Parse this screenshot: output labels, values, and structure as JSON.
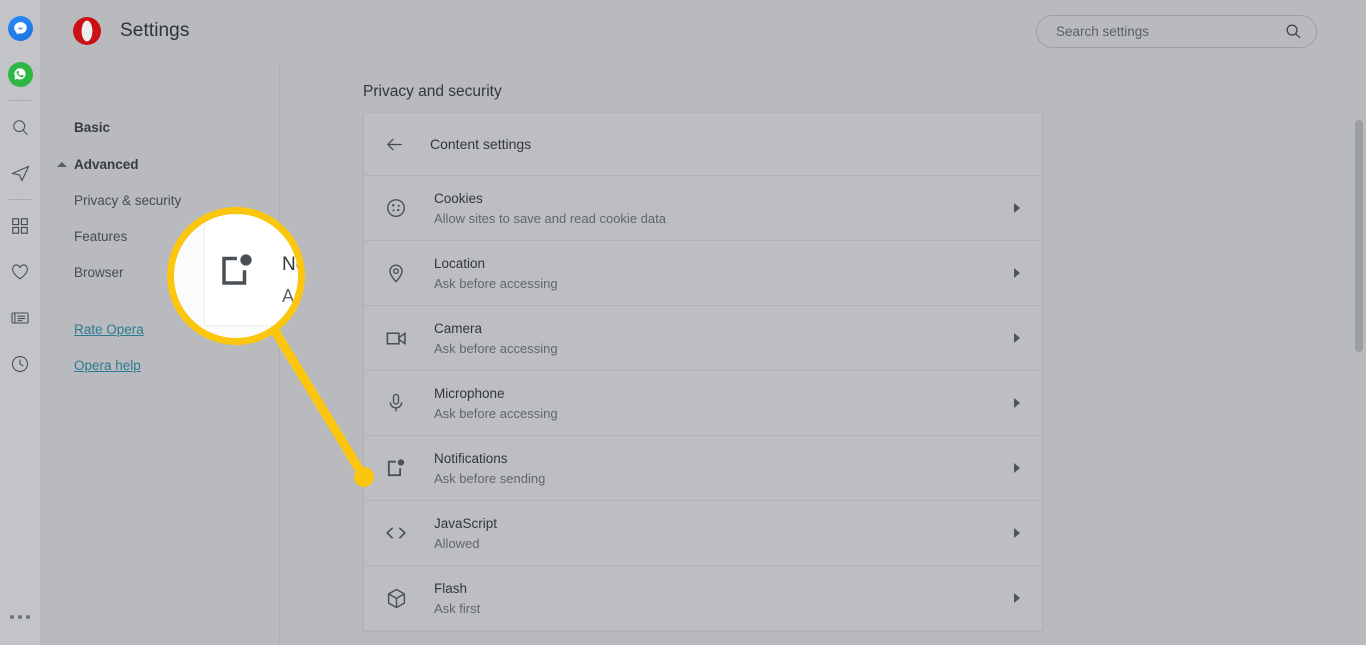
{
  "browser_sidebar": {
    "items": [
      {
        "name": "messenger-icon",
        "label": "Messenger"
      },
      {
        "name": "whatsapp-icon",
        "label": "WhatsApp"
      },
      {
        "name": "divider-1",
        "label": ""
      },
      {
        "name": "search-icon",
        "label": "Search"
      },
      {
        "name": "telegram-icon",
        "label": "Telegram"
      },
      {
        "name": "divider-2",
        "label": ""
      },
      {
        "name": "speed-dial-icon",
        "label": "Speed Dial"
      },
      {
        "name": "heart-icon",
        "label": "Favorites"
      },
      {
        "name": "news-icon",
        "label": "News"
      },
      {
        "name": "history-icon",
        "label": "History"
      }
    ],
    "more_label": "More"
  },
  "header": {
    "logo_name": "opera-logo",
    "title": "Settings"
  },
  "search": {
    "placeholder": "Search settings",
    "value": "",
    "icon": "search-icon"
  },
  "nav": {
    "basic_label": "Basic",
    "advanced_label": "Advanced",
    "sub_items": [
      {
        "label": "Privacy & security"
      },
      {
        "label": "Features"
      },
      {
        "label": "Browser"
      }
    ],
    "links": [
      {
        "label": "Rate Opera"
      },
      {
        "label": "Opera help"
      }
    ]
  },
  "main": {
    "page_title": "Privacy and security",
    "card_header": {
      "back_icon": "back-arrow-icon",
      "title": "Content settings"
    },
    "rows": [
      {
        "icon": "cookie-icon",
        "title": "Cookies",
        "subtitle": "Allow sites to save and read cookie data"
      },
      {
        "icon": "location-pin-icon",
        "title": "Location",
        "subtitle": "Ask before accessing"
      },
      {
        "icon": "camera-icon",
        "title": "Camera",
        "subtitle": "Ask before accessing"
      },
      {
        "icon": "microphone-icon",
        "title": "Microphone",
        "subtitle": "Ask before accessing"
      },
      {
        "icon": "notifications-icon",
        "title": "Notifications",
        "subtitle": "Ask before sending"
      },
      {
        "icon": "code-brackets-icon",
        "title": "JavaScript",
        "subtitle": "Allowed"
      },
      {
        "icon": "cube-icon",
        "title": "Flash",
        "subtitle": "Ask first"
      }
    ]
  },
  "callout": {
    "magnified_icon": "notifications-icon",
    "magnified_title": "Notifications",
    "magnified_subtitle": "Ask before sending",
    "highlight_color": "#fcc60f"
  },
  "colors": {
    "page_background": "#b8babd",
    "sidebar_background": "#c2c4c8",
    "link_color": "#2d7b92",
    "opera_red": "#cc0f16",
    "text_primary": "#33373d",
    "text_secondary": "#62666c",
    "highlight": "#fcc60f"
  }
}
